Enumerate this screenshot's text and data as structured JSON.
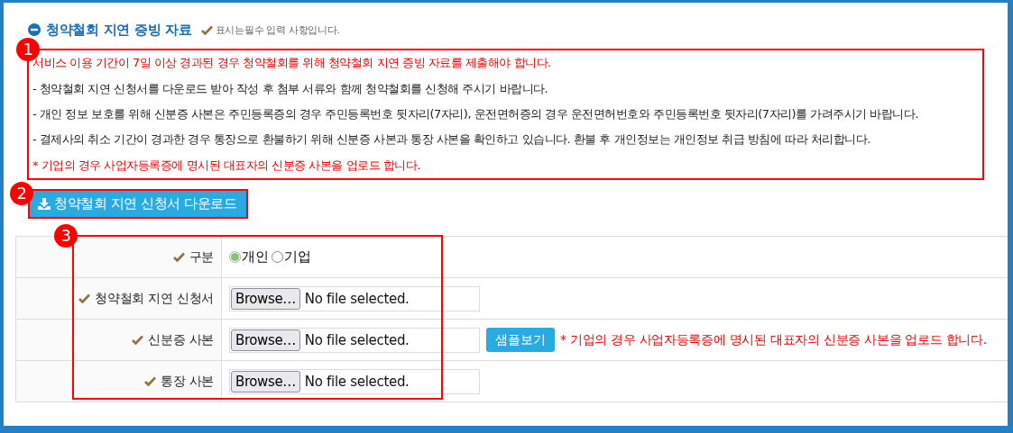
{
  "section": {
    "title": "청약철회 지연 증빙 자료",
    "required_note": "표시는필수 입력 사항입니다."
  },
  "notices": [
    {
      "text": "서비스 이용 기간이 7일 이상 경과된 경우 청약철회를 위해 청약철회 지연 증빙 자료를 제출해야 합니다.",
      "kind": "warning"
    },
    {
      "text": "- 청약철회 지연 신청서를 다운로드 받아 작성 후 첨부 서류와 함께 청약철회를 신청해 주시기 바랍니다.",
      "kind": "plain"
    },
    {
      "text": "- 개인 정보 보호를 위해 신분증 사본은 주민등록증의 경우 주민등록번호 뒷자리(7자리), 운전면허증의 경우 운전면허번호와 주민등록번호 뒷자리(7자리)를 가려주시기 바랍니다.",
      "kind": "plain"
    },
    {
      "text": "- 결제사의 취소 기간이 경과한 경우 통장으로 환불하기 위해 신분증 사본과 통장 사본을 확인하고 있습니다. 환불 후 개인정보는 개인정보 취급 방침에 따라 처리합니다.",
      "kind": "plain"
    },
    {
      "text": "* 기업의 경우 사업자등록증에 명시된 대표자의 신분증 사본을 업로드 합니다.",
      "kind": "warning"
    }
  ],
  "download_button": "청약철회 지연 신청서 다운로드",
  "form_rows": [
    {
      "label": "구분",
      "kind": "radio",
      "options": [
        {
          "label": "개인",
          "selected": true
        },
        {
          "label": "기업",
          "selected": false
        }
      ]
    },
    {
      "label": "청약철회 지연 신청서",
      "kind": "file",
      "button": "Browse…",
      "status": "No file selected."
    },
    {
      "label": "신분증 사본",
      "kind": "file",
      "button": "Browse…",
      "status": "No file selected.",
      "sample_button": "샘플보기",
      "note": "* 기업의 경우 사업자등록증에 명시된 대표자의 신분증 사본을 업로드 합니다."
    },
    {
      "label": "통장 사본",
      "kind": "file",
      "button": "Browse…",
      "status": "No file selected."
    }
  ],
  "annotations": [
    {
      "number": "1"
    },
    {
      "number": "2"
    },
    {
      "number": "3"
    }
  ]
}
